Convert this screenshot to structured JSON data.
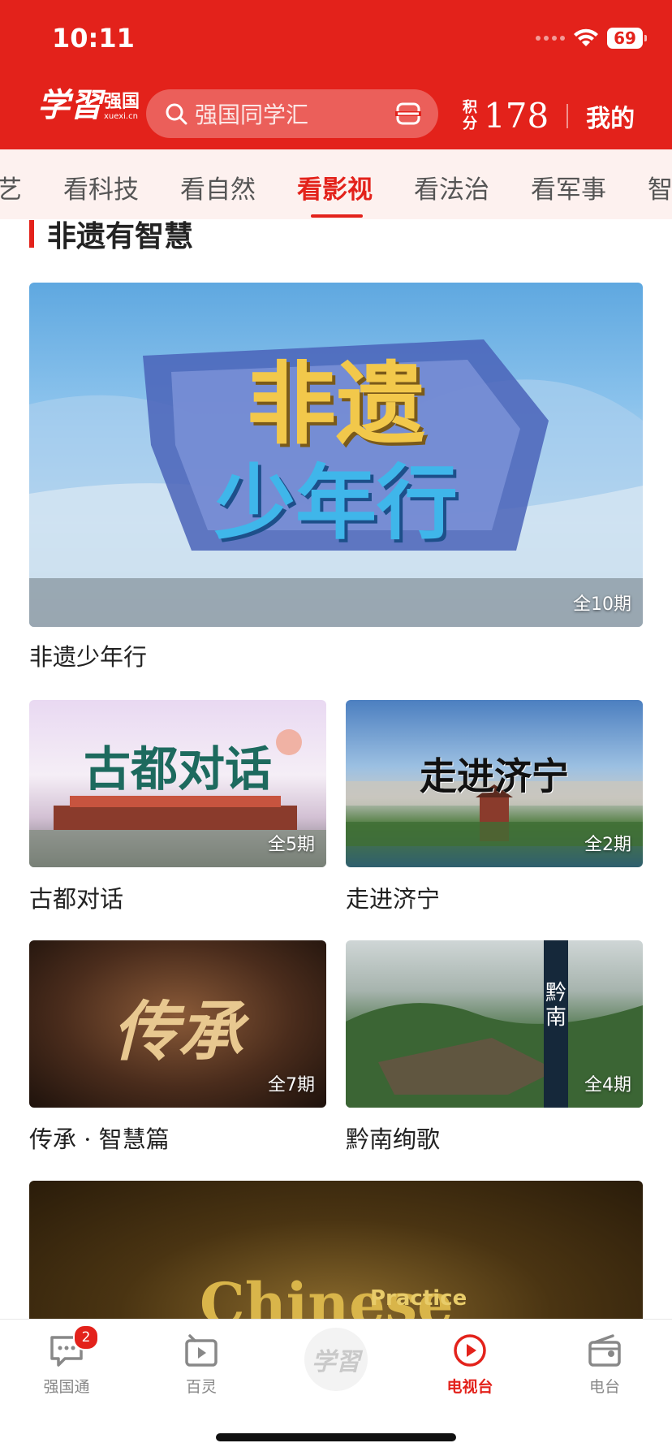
{
  "status_bar": {
    "time": "10:11",
    "battery": "69"
  },
  "header": {
    "logo_mark": "学習",
    "logo_name": "强国",
    "logo_url": "xuexi.cn",
    "search_placeholder": "强国同学汇",
    "points_label": "积分",
    "points_value": "178",
    "mine_label": "我的"
  },
  "tabs": [
    {
      "label": "艺",
      "active": false
    },
    {
      "label": "看科技",
      "active": false
    },
    {
      "label": "看自然",
      "active": false
    },
    {
      "label": "看影视",
      "active": true
    },
    {
      "label": "看法治",
      "active": false
    },
    {
      "label": "看军事",
      "active": false
    },
    {
      "label": "智",
      "active": false
    }
  ],
  "section": {
    "title": "非遗有智慧"
  },
  "featured": {
    "title": "非遗少年行",
    "episodes": "全10期",
    "thumb_line1": "非遗",
    "thumb_line2": "少年行"
  },
  "cards": [
    {
      "title": "古都对话",
      "episodes": "全5期",
      "thumb_text": "古都对话"
    },
    {
      "title": "走进济宁",
      "episodes": "全2期",
      "thumb_text": "走进济宁"
    },
    {
      "title": "传承 · 智慧篇",
      "episodes": "全7期",
      "thumb_text": "传承"
    },
    {
      "title": "黔南绚歌",
      "episodes": "全4期",
      "thumb_text": "黔南"
    }
  ],
  "bottom_card": {
    "thumb_text": "Chinese",
    "thumb_text2": "Practice"
  },
  "bottom_nav": [
    {
      "label": "强国通",
      "icon": "chat-icon",
      "badge": "2",
      "active": false
    },
    {
      "label": "百灵",
      "icon": "video-icon",
      "active": false
    },
    {
      "label": "",
      "icon": "xuexi-logo-icon",
      "active": false
    },
    {
      "label": "电视台",
      "icon": "play-circle-icon",
      "active": true
    },
    {
      "label": "电台",
      "icon": "radio-icon",
      "active": false
    }
  ],
  "colors": {
    "brand_red": "#e3221b",
    "tab_bg": "#fdf1ef"
  }
}
